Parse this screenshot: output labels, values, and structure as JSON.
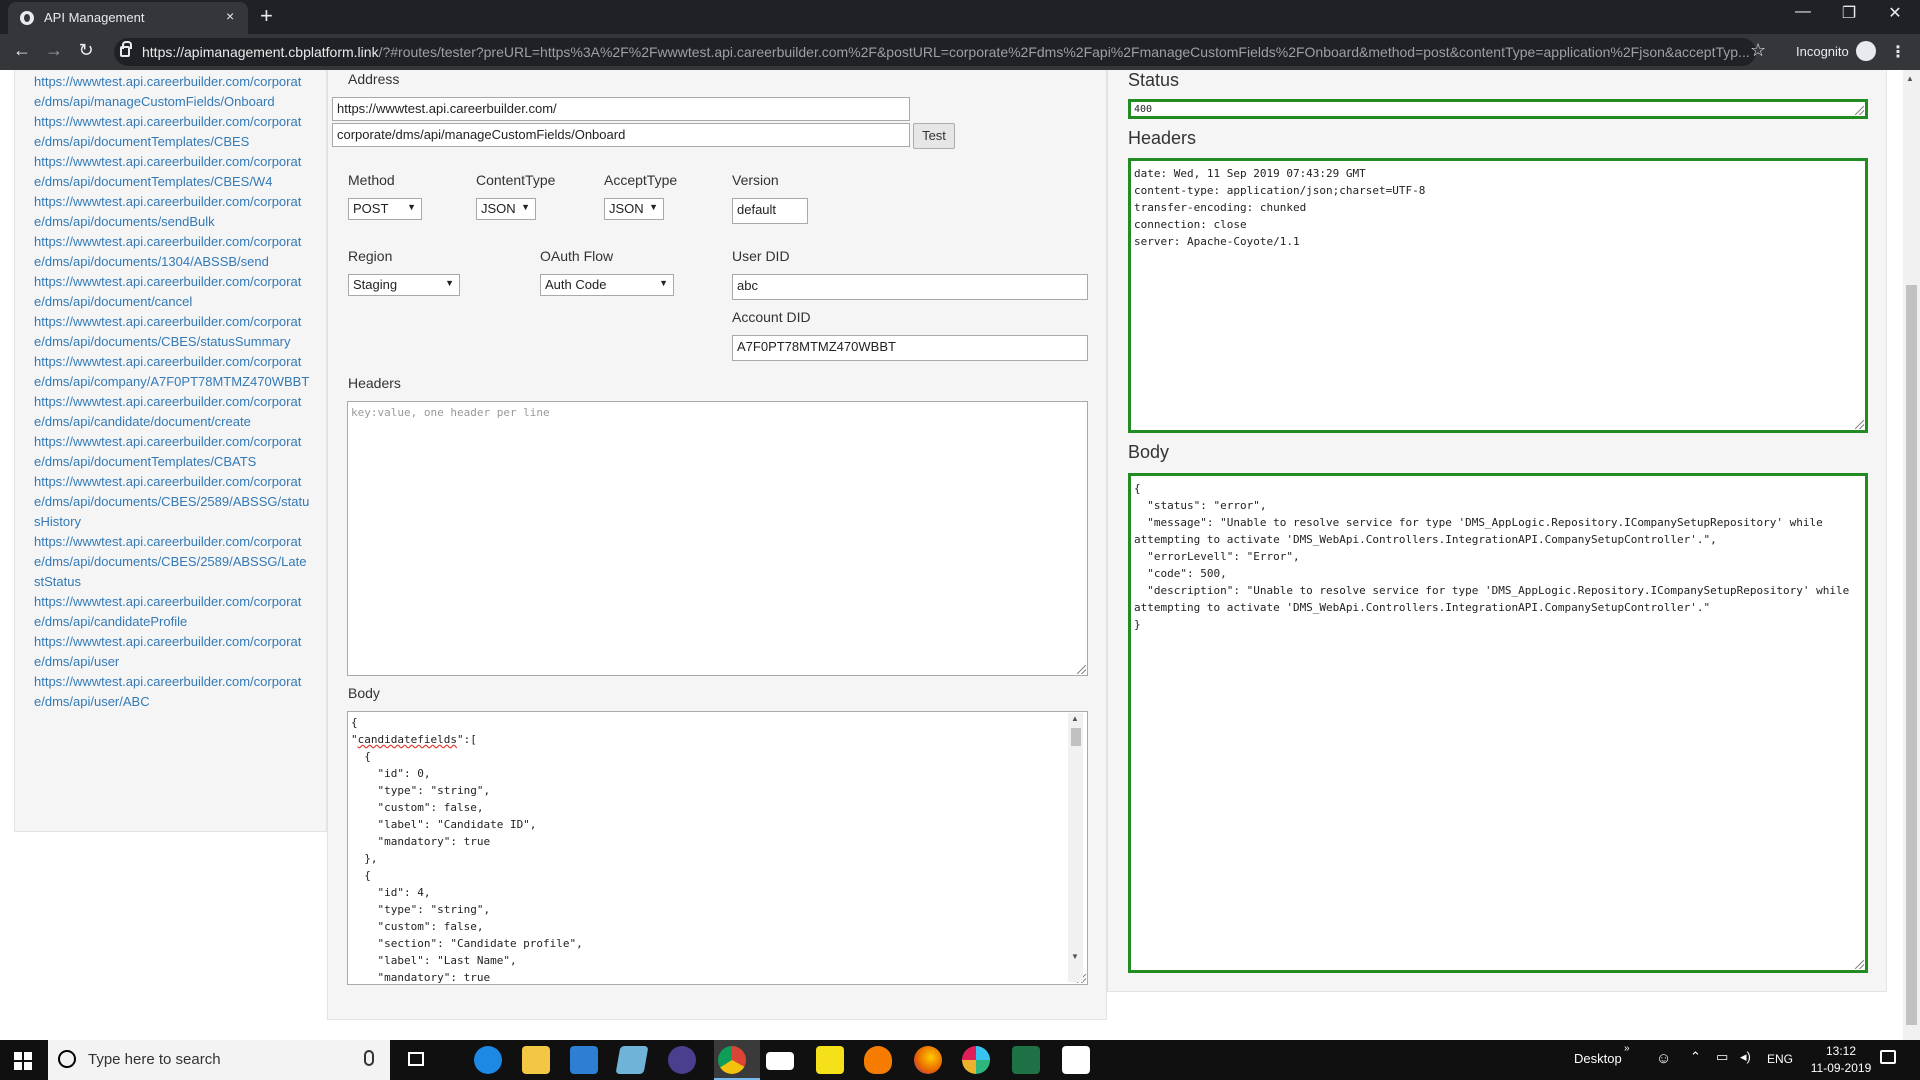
{
  "browser": {
    "tab_title": "API Management",
    "tab_close": "×",
    "new_tab": "+",
    "url_host": "https://apimanagement.cbplatform.link",
    "url_rest": "/?#routes/tester?preURL=https%3A%2F%2Fwwwtest.api.careerbuilder.com%2F&postURL=corporate%2Fdms%2Fapi%2FmanageCustomFields%2FOnboard&method=post&contentType=application%2Fjson&acceptTyp...",
    "incognito_label": "Incognito",
    "back": "←",
    "forward": "→",
    "reload": "↻",
    "minimize": "—",
    "maximize": "❐",
    "close": "✕",
    "star": "☆",
    "menu": "⋮"
  },
  "sidebar": {
    "endpoints": [
      "https://wwwtest.api.careerbuilder.com/corporate/dms/api/manageCustomFields/Onboard",
      "https://wwwtest.api.careerbuilder.com/corporate/dms/api/documentTemplates/CBES",
      "https://wwwtest.api.careerbuilder.com/corporate/dms/api/documentTemplates/CBES/W4",
      "https://wwwtest.api.careerbuilder.com/corporate/dms/api/documents/sendBulk",
      "https://wwwtest.api.careerbuilder.com/corporate/dms/api/documents/1304/ABSSB/send",
      "https://wwwtest.api.careerbuilder.com/corporate/dms/api/document/cancel",
      "https://wwwtest.api.careerbuilder.com/corporate/dms/api/documents/CBES/statusSummary",
      "https://wwwtest.api.careerbuilder.com/corporate/dms/api/company/A7F0PT78MTMZ470WBBT",
      "https://wwwtest.api.careerbuilder.com/corporate/dms/api/candidate/document/create",
      "https://wwwtest.api.careerbuilder.com/corporate/dms/api/documentTemplates/CBATS",
      "https://wwwtest.api.careerbuilder.com/corporate/dms/api/documents/CBES/2589/ABSSG/statusHistory",
      "https://wwwtest.api.careerbuilder.com/corporate/dms/api/documents/CBES/2589/ABSSG/LatestStatus",
      "https://wwwtest.api.careerbuilder.com/corporate/dms/api/candidateProfile",
      "https://wwwtest.api.careerbuilder.com/corporate/dms/api/user",
      "https://wwwtest.api.careerbuilder.com/corporate/dms/api/user/ABC"
    ]
  },
  "tester": {
    "address_label": "Address",
    "pre_url": "https://wwwtest.api.careerbuilder.com/",
    "post_url": "corporate/dms/api/manageCustomFields/Onboard",
    "test_button": "Test",
    "method_label": "Method",
    "method_value": "POST",
    "content_type_label": "ContentType",
    "content_type_value": "JSON",
    "accept_type_label": "AcceptType",
    "accept_type_value": "JSON",
    "version_label": "Version",
    "version_value": "default",
    "region_label": "Region",
    "region_value": "Staging",
    "oauth_label": "OAuth Flow",
    "oauth_value": "Auth Code",
    "user_did_label": "User DID",
    "user_did_value": "abc",
    "account_did_label": "Account DID",
    "account_did_value": "A7F0PT78MTMZ470WBBT",
    "headers_label": "Headers",
    "headers_placeholder": "key:value, one header per line",
    "body_label": "Body",
    "body_line1": "{",
    "body_key": "candidatefields",
    "body_after_key": "\":[",
    "body_rest": "  {\n    \"id\": 0,\n    \"type\": \"string\",\n    \"custom\": false,\n    \"label\": \"Candidate ID\",\n    \"mandatory\": true\n  },\n  {\n    \"id\": 4,\n    \"type\": \"string\",\n    \"custom\": false,\n    \"section\": \"Candidate profile\",\n    \"label\": \"Last Name\",\n    \"mandatory\": true"
  },
  "response": {
    "status_label": "Status",
    "status_value": "400",
    "headers_label": "Headers",
    "headers_text": "date: Wed, 11 Sep 2019 07:43:29 GMT\ncontent-type: application/json;charset=UTF-8\ntransfer-encoding: chunked\nconnection: close\nserver: Apache-Coyote/1.1",
    "body_label": "Body",
    "body_text": "{\n  \"status\": \"error\",\n  \"message\": \"Unable to resolve service for type 'DMS_AppLogic.Repository.ICompanySetupRepository' while\nattempting to activate 'DMS_WebApi.Controllers.IntegrationAPI.CompanySetupController'.\",\n  \"errorLevell\": \"Error\",\n  \"code\": 500,\n  \"description\": \"Unable to resolve service for type 'DMS_AppLogic.Repository.ICompanySetupRepository' while\nattempting to activate 'DMS_WebApi.Controllers.IntegrationAPI.CompanySetupController'.\"\n}",
    "border_color": "#228b22"
  },
  "taskbar": {
    "search_placeholder": "Type here to search",
    "desktop_label": "Desktop",
    "language": "ENG",
    "time": "13:12",
    "date": "11-09-2019"
  }
}
